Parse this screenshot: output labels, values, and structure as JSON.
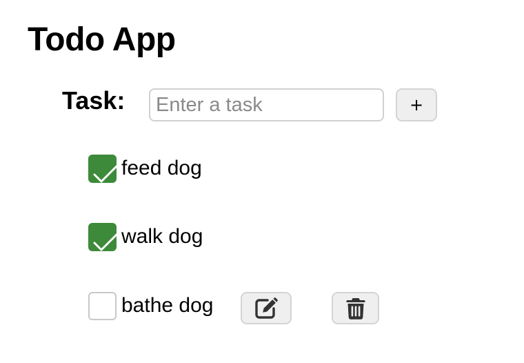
{
  "app": {
    "title": "Todo App"
  },
  "form": {
    "label": "Task:",
    "input_value": "",
    "input_placeholder": "Enter a task",
    "add_button_label": "+"
  },
  "todos": [
    {
      "text": "feed dog",
      "done": true
    },
    {
      "text": "walk dog",
      "done": true
    },
    {
      "text": "bathe dog",
      "done": false,
      "actions": [
        "edit-icon",
        "trash-icon"
      ]
    }
  ],
  "colors": {
    "checked": "#3d8a3a",
    "button_bg": "#efefef",
    "border": "#d0d0d0"
  }
}
